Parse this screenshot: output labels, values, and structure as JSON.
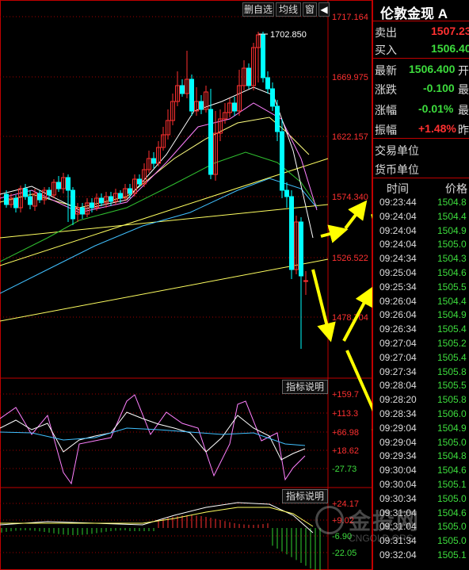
{
  "toolbar": {
    "del_label": "删自选",
    "ma_label": "均线",
    "win_label": "窗"
  },
  "price_axis": [
    "1717.164",
    "1669.975",
    "1622.157",
    "1574.340",
    "1526.522",
    "1478.704"
  ],
  "peak_label": "1702.850",
  "indicator1": {
    "button": "指标说明",
    "axis": [
      "+159.7",
      "+113.3",
      "+66.98",
      "+18.62",
      "-27.73"
    ]
  },
  "indicator2": {
    "button": "指标说明",
    "axis": [
      "+24.17",
      "+9.02",
      "-6.90",
      "-22.05"
    ]
  },
  "watermark": "金投网 CNGOLD.ORG",
  "quote": {
    "title": "伦敦金现 A",
    "sell": {
      "label": "卖出",
      "value": "1507.23"
    },
    "buy": {
      "label": "买入",
      "value": "1506.40"
    },
    "latest": {
      "label": "最新",
      "value": "1506.400",
      "suffix": "开"
    },
    "change": {
      "label": "涨跌",
      "value": "-0.100",
      "suffix": "最"
    },
    "change_pct": {
      "label": "涨幅",
      "value": "-0.01%",
      "suffix": "最"
    },
    "amplitude": {
      "label": "振幅",
      "value": "+1.48%",
      "suffix": "昨"
    },
    "trade_unit": "交易单位",
    "currency_unit": "货币单位",
    "col_time": "时间",
    "col_price": "价格"
  },
  "ticks": [
    {
      "time": "09:23:44",
      "price": "1504.8"
    },
    {
      "time": "09:24:04",
      "price": "1504.4"
    },
    {
      "time": "09:24:04",
      "price": "1504.9"
    },
    {
      "time": "09:24:04",
      "price": "1505.0"
    },
    {
      "time": "09:24:34",
      "price": "1504.3"
    },
    {
      "time": "09:25:04",
      "price": "1504.6"
    },
    {
      "time": "09:25:34",
      "price": "1505.5"
    },
    {
      "time": "09:26:04",
      "price": "1504.4"
    },
    {
      "time": "09:26:04",
      "price": "1504.9"
    },
    {
      "time": "09:26:34",
      "price": "1505.4"
    },
    {
      "time": "09:27:04",
      "price": "1505.2"
    },
    {
      "time": "09:27:04",
      "price": "1505.4"
    },
    {
      "time": "09:27:34",
      "price": "1505.8"
    },
    {
      "time": "09:28:04",
      "price": "1505.5"
    },
    {
      "time": "09:28:20",
      "price": "1505.8"
    },
    {
      "time": "09:28:34",
      "price": "1506.0"
    },
    {
      "time": "09:29:04",
      "price": "1504.9"
    },
    {
      "time": "09:29:04",
      "price": "1505.0"
    },
    {
      "time": "09:29:34",
      "price": "1504.8"
    },
    {
      "time": "09:30:04",
      "price": "1504.6"
    },
    {
      "time": "09:30:04",
      "price": "1505.1"
    },
    {
      "time": "09:30:34",
      "price": "1505.0"
    },
    {
      "time": "09:31:04",
      "price": "1504.6"
    },
    {
      "time": "09:31:04",
      "price": "1505.0"
    },
    {
      "time": "09:31:34",
      "price": "1505.0"
    },
    {
      "time": "09:32:04",
      "price": "1505.1"
    }
  ],
  "colors": {
    "up": "#ff3030",
    "down": "#00ffff",
    "grid": "#a00000",
    "arrow": "#ffff00",
    "tick_price": "#3ddc3d"
  }
}
